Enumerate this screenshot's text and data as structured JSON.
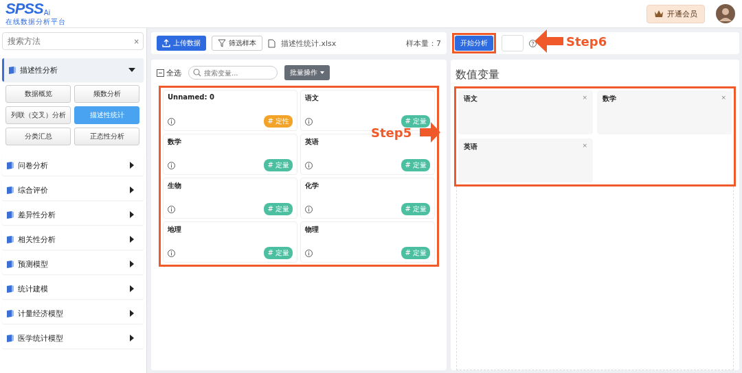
{
  "header": {
    "logo": {
      "name": "SPSS",
      "suffix": "Ai",
      "tagline": "在线数据分析平台"
    },
    "vip_button": "开通会员"
  },
  "sidebar": {
    "search": {
      "placeholder": "搜索方法",
      "clear": "×"
    },
    "groups": [
      {
        "label": "描述性分析",
        "expanded": true,
        "items": [
          {
            "label": "数据概览",
            "selected": false
          },
          {
            "label": "频数分析",
            "selected": false
          },
          {
            "label": "列联（交叉）分析",
            "selected": false
          },
          {
            "label": "描述性统计",
            "selected": true
          },
          {
            "label": "分类汇总",
            "selected": false
          },
          {
            "label": "正态性分析",
            "selected": false
          }
        ]
      },
      {
        "label": "问卷分析",
        "expanded": false
      },
      {
        "label": "综合评价",
        "expanded": false
      },
      {
        "label": "差异性分析",
        "expanded": false
      },
      {
        "label": "相关性分析",
        "expanded": false
      },
      {
        "label": "预测模型",
        "expanded": false
      },
      {
        "label": "统计建模",
        "expanded": false
      },
      {
        "label": "计量经济模型",
        "expanded": false
      },
      {
        "label": "医学统计模型",
        "expanded": false
      }
    ]
  },
  "data_toolbar": {
    "upload_button": "上传数据",
    "filter_button": "筛选样本",
    "file_name": "描述性统计.xlsx",
    "sample_size": "样本量：7"
  },
  "variables": {
    "select_all": "全选",
    "select_all_indeterminate": true,
    "search": {
      "placeholder": "搜索变量..."
    },
    "batch_button": "批量操作",
    "highlighted": true,
    "items": [
      {
        "name": "Unnamed: 0",
        "tag": "# 定性",
        "kind": "qualitative"
      },
      {
        "name": "语文",
        "tag": "# 定量",
        "kind": "quantitative"
      },
      {
        "name": "数学",
        "tag": "# 定量",
        "kind": "quantitative"
      },
      {
        "name": "英语",
        "tag": "# 定量",
        "kind": "quantitative"
      },
      {
        "name": "生物",
        "tag": "# 定量",
        "kind": "quantitative"
      },
      {
        "name": "化学",
        "tag": "# 定量",
        "kind": "quantitative"
      },
      {
        "name": "地理",
        "tag": "# 定量",
        "kind": "quantitative"
      },
      {
        "name": "物理",
        "tag": "# 定量",
        "kind": "quantitative"
      }
    ]
  },
  "analysis": {
    "start_button": "开始分析",
    "start_highlighted": true,
    "section_title": "数值变量",
    "selected_highlighted": true,
    "selected_variables": [
      {
        "name": "语文",
        "remove": "×"
      },
      {
        "name": "数学",
        "remove": "×"
      },
      {
        "name": "英语",
        "remove": "×"
      }
    ]
  },
  "annotations": [
    {
      "kind": "arrow-left",
      "label": "Step6"
    },
    {
      "kind": "arrow-right",
      "label": "Step5"
    }
  ]
}
